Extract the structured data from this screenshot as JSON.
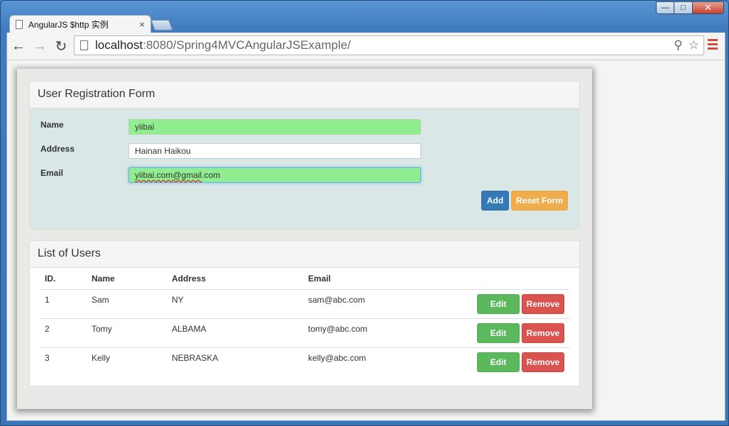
{
  "browser": {
    "tab_title": "AngularJS $http 实例",
    "tab_close": "×",
    "url_host": "localhost",
    "url_rest": ":8080/Spring4MVCAngularJSExample/"
  },
  "form": {
    "heading": "User Registration Form",
    "name_label": "Name",
    "name_value": "yiibai",
    "address_label": "Address",
    "address_value": "Hainan Haikou",
    "email_label": "Email",
    "email_value_spell": "yiibai.com@gmail",
    "email_value_rest": ".com",
    "add_label": "Add",
    "reset_label": "Reset Form",
    "valid_color": "#90ee90"
  },
  "users": {
    "heading": "List of Users",
    "columns": [
      "ID.",
      "Name",
      "Address",
      "Email"
    ],
    "rows": [
      {
        "id": "1",
        "name": "Sam",
        "address": "NY",
        "email": "sam@abc.com"
      },
      {
        "id": "2",
        "name": "Tomy",
        "address": "ALBAMA",
        "email": "tomy@abc.com"
      },
      {
        "id": "3",
        "name": "Kelly",
        "address": "NEBRASKA",
        "email": "kelly@abc.com"
      }
    ],
    "edit_label": "Edit",
    "remove_label": "Remove"
  }
}
